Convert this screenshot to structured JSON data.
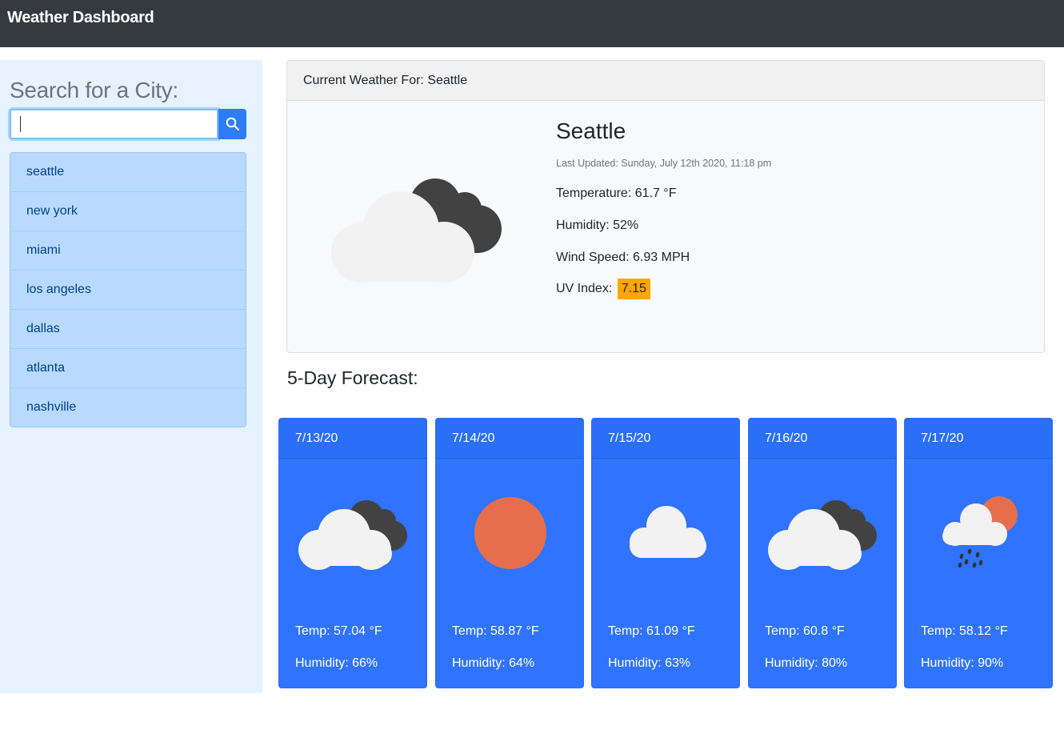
{
  "navbar": {
    "brand": "Weather Dashboard"
  },
  "sidebar": {
    "heading": "Search for a City:",
    "search": {
      "value": "",
      "placeholder": ""
    },
    "cities": [
      "seattle",
      "new york",
      "miami",
      "los angeles",
      "dallas",
      "atlanta",
      "nashville"
    ]
  },
  "current": {
    "header": "Current Weather For: Seattle",
    "city": "Seattle",
    "icon": "cloudy-icon",
    "last_updated": "Last Updated: Sunday, July 12th 2020, 11:18 pm",
    "temperature": "Temperature: 61.7 °F",
    "humidity": "Humidity: 52%",
    "wind": "Wind Speed: 6.93 MPH",
    "uv_label": "UV Index:",
    "uv_value": "7.15",
    "uv_color": "#ffa600"
  },
  "forecast": {
    "title": "5-Day Forecast:",
    "days": [
      {
        "date": "7/13/20",
        "icon": "cloudy-icon",
        "temp": "Temp: 57.04 °F",
        "humidity": "Humidity: 66%"
      },
      {
        "date": "7/14/20",
        "icon": "sun-icon",
        "temp": "Temp: 58.87 °F",
        "humidity": "Humidity: 64%"
      },
      {
        "date": "7/15/20",
        "icon": "cloud-icon",
        "temp": "Temp: 61.09 °F",
        "humidity": "Humidity: 63%"
      },
      {
        "date": "7/16/20",
        "icon": "cloudy-icon",
        "temp": "Temp: 60.8 °F",
        "humidity": "Humidity: 80%"
      },
      {
        "date": "7/17/20",
        "icon": "rain-sun-icon",
        "temp": "Temp: 58.12 °F",
        "humidity": "Humidity: 90%"
      }
    ]
  },
  "colors": {
    "navbar": "#343a40",
    "accent": "#2f73fe",
    "sidebar": "#e6f2fe",
    "list_item": "#b8daff"
  }
}
